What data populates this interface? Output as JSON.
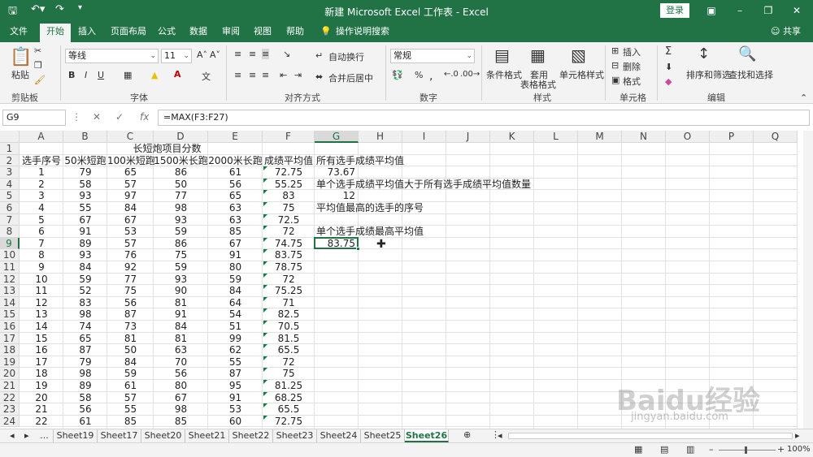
{
  "titlebar": {
    "title": "新建 Microsoft Excel 工作表 - Excel",
    "login": "登录"
  },
  "tabs": [
    "文件",
    "开始",
    "插入",
    "页面布局",
    "公式",
    "数据",
    "审阅",
    "视图",
    "帮助"
  ],
  "tabs_active": "开始",
  "tellme": "操作说明搜索",
  "share": "共享",
  "ribbon": {
    "clipboard": {
      "paste": "粘贴",
      "label": "剪贴板"
    },
    "font": {
      "name": "等线",
      "size": "11",
      "label": "字体",
      "bold": "B",
      "italic": "I",
      "underline": "U"
    },
    "align": {
      "wrap": "自动换行",
      "merge": "合并后居中",
      "label": "对齐方式"
    },
    "number": {
      "format": "常规",
      "label": "数字"
    },
    "styles": {
      "cond": "条件格式",
      "table1": "套用",
      "table2": "表格格式",
      "cell": "单元格样式",
      "label": "样式"
    },
    "cells": {
      "insert": "插入",
      "delete": "删除",
      "format": "格式",
      "label": "单元格"
    },
    "edit": {
      "sort": "排序和筛选",
      "find": "查找和选择",
      "label": "编辑"
    }
  },
  "formula_bar": {
    "name_box": "G9",
    "formula": "=MAX(F3:F27)"
  },
  "columns": [
    "A",
    "B",
    "C",
    "D",
    "E",
    "F",
    "G",
    "H",
    "I",
    "J",
    "K",
    "L",
    "M",
    "N",
    "O",
    "P",
    "Q"
  ],
  "rows": [
    "1",
    "2",
    "3",
    "4",
    "5",
    "6",
    "7",
    "8",
    "9",
    "10",
    "11",
    "12",
    "13",
    "14",
    "15",
    "16",
    "17",
    "18",
    "19",
    "20",
    "21",
    "22",
    "23",
    "24"
  ],
  "sheet": {
    "title": "长短炮项目分数",
    "headers": [
      "选手序号",
      "50米短跑",
      "100米短跑",
      "1500米长跑",
      "2000米长跑",
      "成绩平均值"
    ],
    "data": [
      [
        "1",
        "79",
        "65",
        "86",
        "61",
        "72.75"
      ],
      [
        "2",
        "58",
        "57",
        "50",
        "56",
        "55.25"
      ],
      [
        "3",
        "93",
        "97",
        "77",
        "65",
        "83"
      ],
      [
        "4",
        "55",
        "84",
        "98",
        "63",
        "75"
      ],
      [
        "5",
        "67",
        "67",
        "93",
        "63",
        "72.5"
      ],
      [
        "6",
        "91",
        "53",
        "59",
        "85",
        "72"
      ],
      [
        "7",
        "89",
        "57",
        "86",
        "67",
        "74.75"
      ],
      [
        "8",
        "93",
        "76",
        "75",
        "91",
        "83.75"
      ],
      [
        "9",
        "84",
        "92",
        "59",
        "80",
        "78.75"
      ],
      [
        "10",
        "59",
        "77",
        "93",
        "59",
        "72"
      ],
      [
        "11",
        "52",
        "75",
        "90",
        "84",
        "75.25"
      ],
      [
        "12",
        "83",
        "56",
        "81",
        "64",
        "71"
      ],
      [
        "13",
        "98",
        "87",
        "91",
        "54",
        "82.5"
      ],
      [
        "14",
        "74",
        "73",
        "84",
        "51",
        "70.5"
      ],
      [
        "15",
        "65",
        "81",
        "81",
        "99",
        "81.5"
      ],
      [
        "16",
        "87",
        "50",
        "63",
        "62",
        "65.5"
      ],
      [
        "17",
        "79",
        "84",
        "70",
        "55",
        "72"
      ],
      [
        "18",
        "98",
        "59",
        "56",
        "87",
        "75"
      ],
      [
        "19",
        "89",
        "61",
        "80",
        "95",
        "81.25"
      ],
      [
        "20",
        "58",
        "57",
        "67",
        "91",
        "68.25"
      ],
      [
        "21",
        "56",
        "55",
        "98",
        "53",
        "65.5"
      ],
      [
        "22",
        "61",
        "85",
        "85",
        "60",
        "72.75"
      ]
    ],
    "g_notes": {
      "g2": "所有选手成绩平均值",
      "g3": "73.67",
      "g4": "单个选手成绩平均值大于所有选手成绩平均值数量",
      "g5": "12",
      "g6": "平均值最高的选手的序号",
      "g8": "单个选手成绩最高平均值",
      "g9": "83.75"
    }
  },
  "sheets": [
    "...",
    "Sheet19",
    "Sheet17",
    "Sheet20",
    "Sheet21",
    "Sheet22",
    "Sheet23",
    "Sheet24",
    "Sheet25",
    "Sheet26"
  ],
  "active_sheet": "Sheet26",
  "status": {
    "zoom": "100%"
  },
  "watermark": {
    "brand": "Baidu经验",
    "url": "jingyan.baidu.com"
  },
  "colors": {
    "accent": "#217346"
  }
}
